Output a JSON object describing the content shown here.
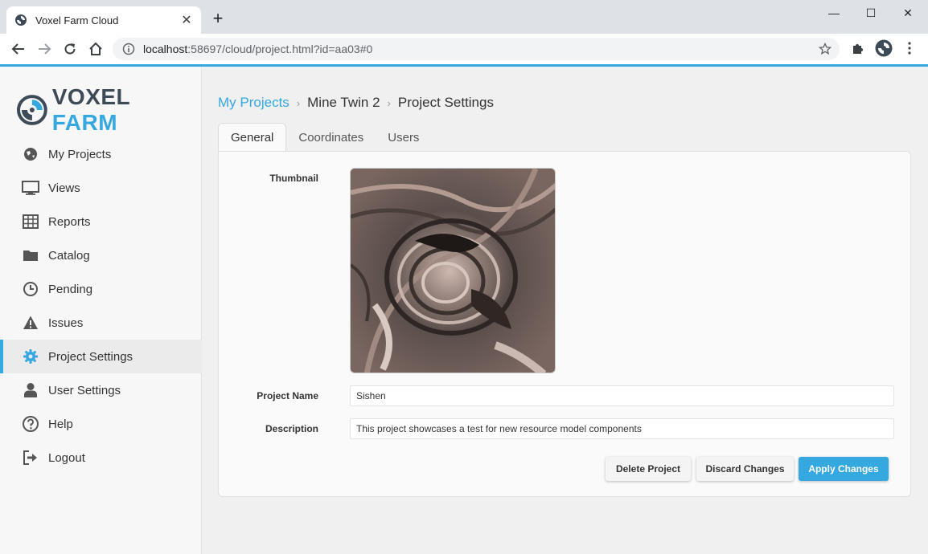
{
  "browser": {
    "tab_title": "Voxel Farm Cloud",
    "tab_close": "✕",
    "new_tab": "+",
    "url_host": "localhost",
    "url_rest": ":58697/cloud/project.html?id=aa03#0",
    "window_controls": [
      "—",
      "☐",
      "✕"
    ]
  },
  "logo": {
    "word1": "VOXEL",
    "word2": "FARM"
  },
  "sidebar": {
    "items": [
      {
        "label": "My Projects",
        "icon": "globe-icon"
      },
      {
        "label": "Views",
        "icon": "monitor-icon"
      },
      {
        "label": "Reports",
        "icon": "table-icon"
      },
      {
        "label": "Catalog",
        "icon": "folder-icon"
      },
      {
        "label": "Pending",
        "icon": "clock-icon"
      },
      {
        "label": "Issues",
        "icon": "warning-icon"
      },
      {
        "label": "Project Settings",
        "icon": "gear-icon",
        "active": true
      },
      {
        "label": "User Settings",
        "icon": "user-icon"
      },
      {
        "label": "Help",
        "icon": "help-icon"
      },
      {
        "label": "Logout",
        "icon": "logout-icon"
      }
    ]
  },
  "breadcrumb": {
    "root": "My Projects",
    "project": "Mine Twin 2",
    "current": "Project Settings",
    "separator": "›"
  },
  "tabs": [
    {
      "label": "General",
      "active": true
    },
    {
      "label": "Coordinates"
    },
    {
      "label": "Users"
    }
  ],
  "form": {
    "thumbnail_label": "Thumbnail",
    "name_label": "Project Name",
    "name_value": "Sishen",
    "description_label": "Description",
    "description_value": "This project showcases a test for new resource model components"
  },
  "buttons": {
    "delete": "Delete Project",
    "discard": "Discard Changes",
    "apply": "Apply Changes"
  },
  "colors": {
    "accent": "#35a8e0",
    "logo_dark": "#3d4a57"
  }
}
